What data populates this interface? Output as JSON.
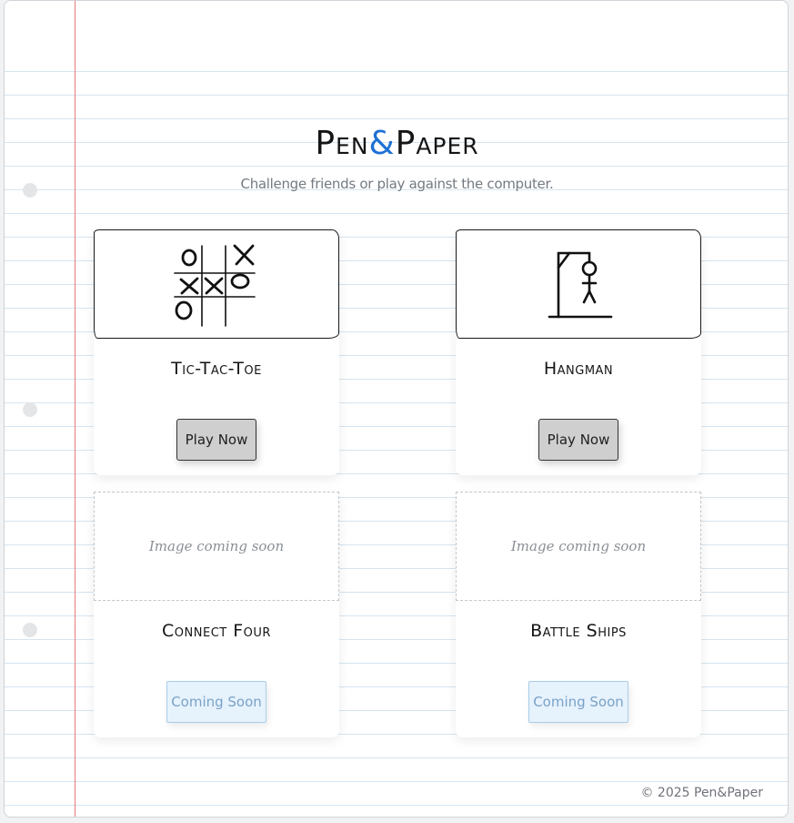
{
  "header": {
    "title_part1": "Pen",
    "title_amp": "&",
    "title_part2": "Paper",
    "subtitle": "Challenge friends or play against the computer."
  },
  "games": [
    {
      "name": "Tic-Tac-Toe",
      "image": "tic-tac-toe-sketch",
      "button_label": "Play Now",
      "available": true
    },
    {
      "name": "Hangman",
      "image": "hangman-sketch",
      "button_label": "Play Now",
      "available": true
    },
    {
      "name": "Connect Four",
      "image_placeholder": "Image coming soon",
      "button_label": "Coming Soon",
      "available": false
    },
    {
      "name": "Battle Ships",
      "image_placeholder": "Image coming soon",
      "button_label": "Coming Soon",
      "available": false
    }
  ],
  "footer": {
    "copyright": "© 2025 Pen&Paper"
  },
  "colors": {
    "accent": "#1e70d3",
    "margin_line": "#e47a7a",
    "rule_line": "#d5e5f1",
    "play_button": "#cfcfcf",
    "coming_soon_bg": "#e6f2fc",
    "coming_soon_text": "#7aa2c8"
  }
}
